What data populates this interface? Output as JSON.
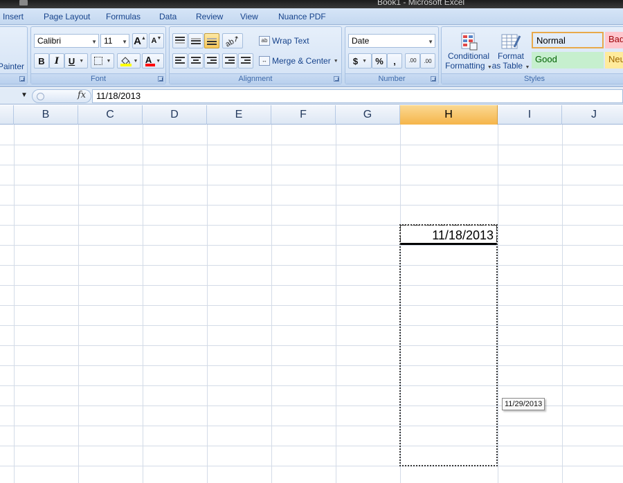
{
  "window": {
    "title": "Book1 - Microsoft Excel"
  },
  "ribbon_tabs": [
    "Insert",
    "Page Layout",
    "Formulas",
    "Data",
    "Review",
    "View",
    "Nuance PDF"
  ],
  "clipboard": {
    "format_painter_label": "Painter"
  },
  "font": {
    "group_label": "Font",
    "family": "Calibri",
    "size": "11",
    "bold": "B",
    "italic": "I",
    "underline": "U",
    "font_color_letter": "A",
    "grow": "A",
    "shrink": "A",
    "fill_color": "#ffff00",
    "font_color": "#ff0000"
  },
  "alignment": {
    "group_label": "Alignment",
    "wrap_text": "Wrap Text",
    "merge_center": "Merge & Center"
  },
  "number": {
    "group_label": "Number",
    "format": "Date",
    "currency": "$",
    "percent": "%",
    "comma": ",",
    "increase_decimal": ".00",
    "decrease_decimal": ".00"
  },
  "styles": {
    "group_label": "Styles",
    "conditional_formatting": [
      "Conditional",
      "Formatting"
    ],
    "format_as_table": [
      "Format",
      "as Table"
    ],
    "cells": [
      {
        "label": "Normal",
        "bg": "#ffffff",
        "color": "#000000"
      },
      {
        "label": "Bad",
        "bg": "#ffc7ce",
        "color": "#9c0006"
      },
      {
        "label": "Good",
        "bg": "#c6efce",
        "color": "#006100"
      },
      {
        "label": "Neutral",
        "bg": "#ffeb9c",
        "color": "#9c6500"
      }
    ]
  },
  "formula_bar": {
    "fx": "fx",
    "value": "11/18/2013"
  },
  "sheet": {
    "columns": [
      "B",
      "C",
      "D",
      "E",
      "F",
      "G",
      "H",
      "I",
      "J"
    ],
    "selected_column": "H",
    "active_cell_value": "11/18/2013",
    "fill_tooltip": "11/29/2013"
  }
}
